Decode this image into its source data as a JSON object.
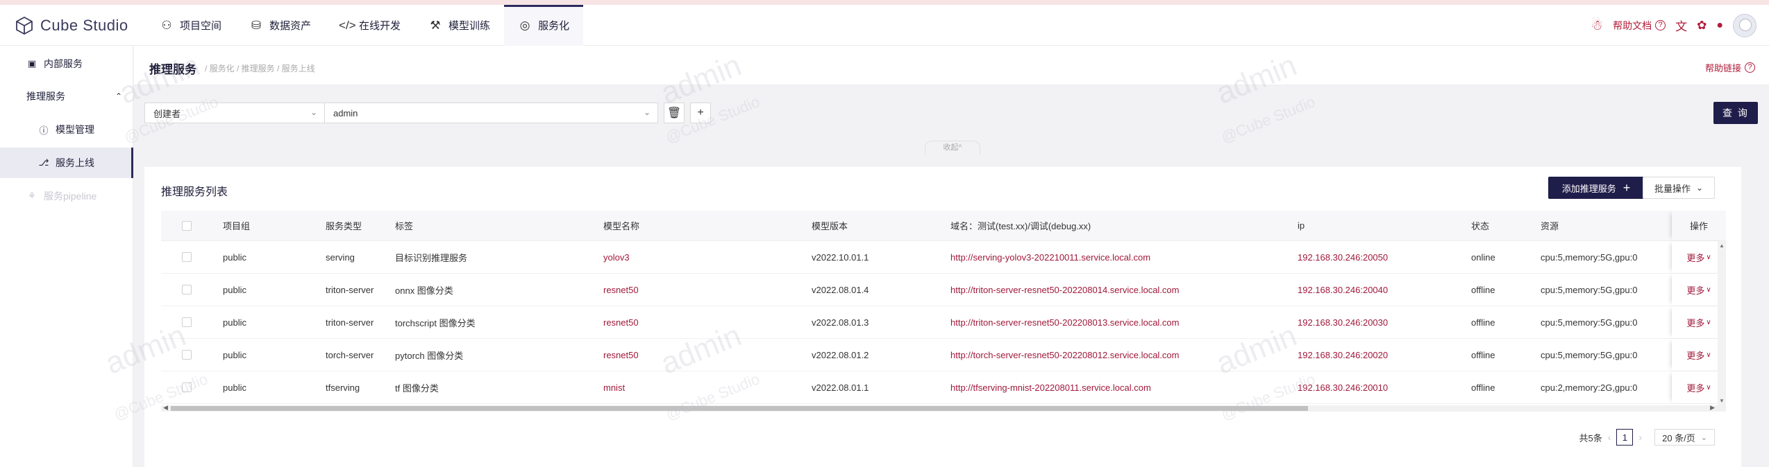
{
  "app": {
    "name": "Cube Studio"
  },
  "nav": [
    {
      "label": "项目空间",
      "icon": "project-icon"
    },
    {
      "label": "数据资产",
      "icon": "database-icon"
    },
    {
      "label": "在线开发",
      "icon": "code-icon"
    },
    {
      "label": "模型训练",
      "icon": "training-icon"
    },
    {
      "label": "服务化",
      "icon": "service-icon",
      "active": true
    }
  ],
  "header_right": {
    "help_doc": "帮助文档"
  },
  "sidebar": {
    "items": [
      {
        "label": "内部服务"
      },
      {
        "label": "推理服务"
      },
      {
        "label": "模型管理"
      },
      {
        "label": "服务上线"
      },
      {
        "label": "服务pipeline"
      }
    ]
  },
  "page": {
    "title": "推理服务",
    "breadcrumb": "/ 服务化 / 推理服务 / 服务上线",
    "help_link": "帮助链接"
  },
  "filter": {
    "field": "创建者",
    "value": "admin",
    "query_label": "查 询",
    "collapse_label": "收起"
  },
  "panel": {
    "title": "推理服务列表",
    "add_label": "添加推理服务",
    "batch_label": "批量操作"
  },
  "table": {
    "columns": [
      "项目组",
      "服务类型",
      "标签",
      "模型名称",
      "模型版本",
      "域名：测试(test.xx)/调试(debug.xx)",
      "ip",
      "状态",
      "资源",
      "操作"
    ],
    "rows": [
      {
        "group": "public",
        "type": "serving",
        "tag": "目标识别推理服务",
        "model": "yolov3",
        "version": "v2022.10.01.1",
        "domain": "http://serving-yolov3-202210011.service.local.com",
        "ip": "192.168.30.246:20050",
        "status": "online",
        "resource": "cpu:5,memory:5G,gpu:0",
        "op": "更多"
      },
      {
        "group": "public",
        "type": "triton-server",
        "tag": "onnx 图像分类",
        "model": "resnet50",
        "version": "v2022.08.01.4",
        "domain": "http://triton-server-resnet50-202208014.service.local.com",
        "ip": "192.168.30.246:20040",
        "status": "offline",
        "resource": "cpu:5,memory:5G,gpu:0",
        "op": "更多"
      },
      {
        "group": "public",
        "type": "triton-server",
        "tag": "torchscript 图像分类",
        "model": "resnet50",
        "version": "v2022.08.01.3",
        "domain": "http://triton-server-resnet50-202208013.service.local.com",
        "ip": "192.168.30.246:20030",
        "status": "offline",
        "resource": "cpu:5,memory:5G,gpu:0",
        "op": "更多"
      },
      {
        "group": "public",
        "type": "torch-server",
        "tag": "pytorch 图像分类",
        "model": "resnet50",
        "version": "v2022.08.01.2",
        "domain": "http://torch-server-resnet50-202208012.service.local.com",
        "ip": "192.168.30.246:20020",
        "status": "offline",
        "resource": "cpu:5,memory:5G,gpu:0",
        "op": "更多"
      },
      {
        "group": "public",
        "type": "tfserving",
        "tag": "tf 图像分类",
        "model": "mnist",
        "version": "v2022.08.01.1",
        "domain": "http://tfserving-mnist-202208011.service.local.com",
        "ip": "192.168.30.246:20010",
        "status": "offline",
        "resource": "cpu:2,memory:2G,gpu:0",
        "op": "更多"
      }
    ]
  },
  "pagination": {
    "total": "共5条",
    "current": "1",
    "page_size": "20 条/页"
  },
  "watermark": {
    "text": "admin",
    "sub": "@Cube Studio"
  },
  "colors": {
    "primary": "#1f1d4a",
    "link": "#a0183a"
  }
}
